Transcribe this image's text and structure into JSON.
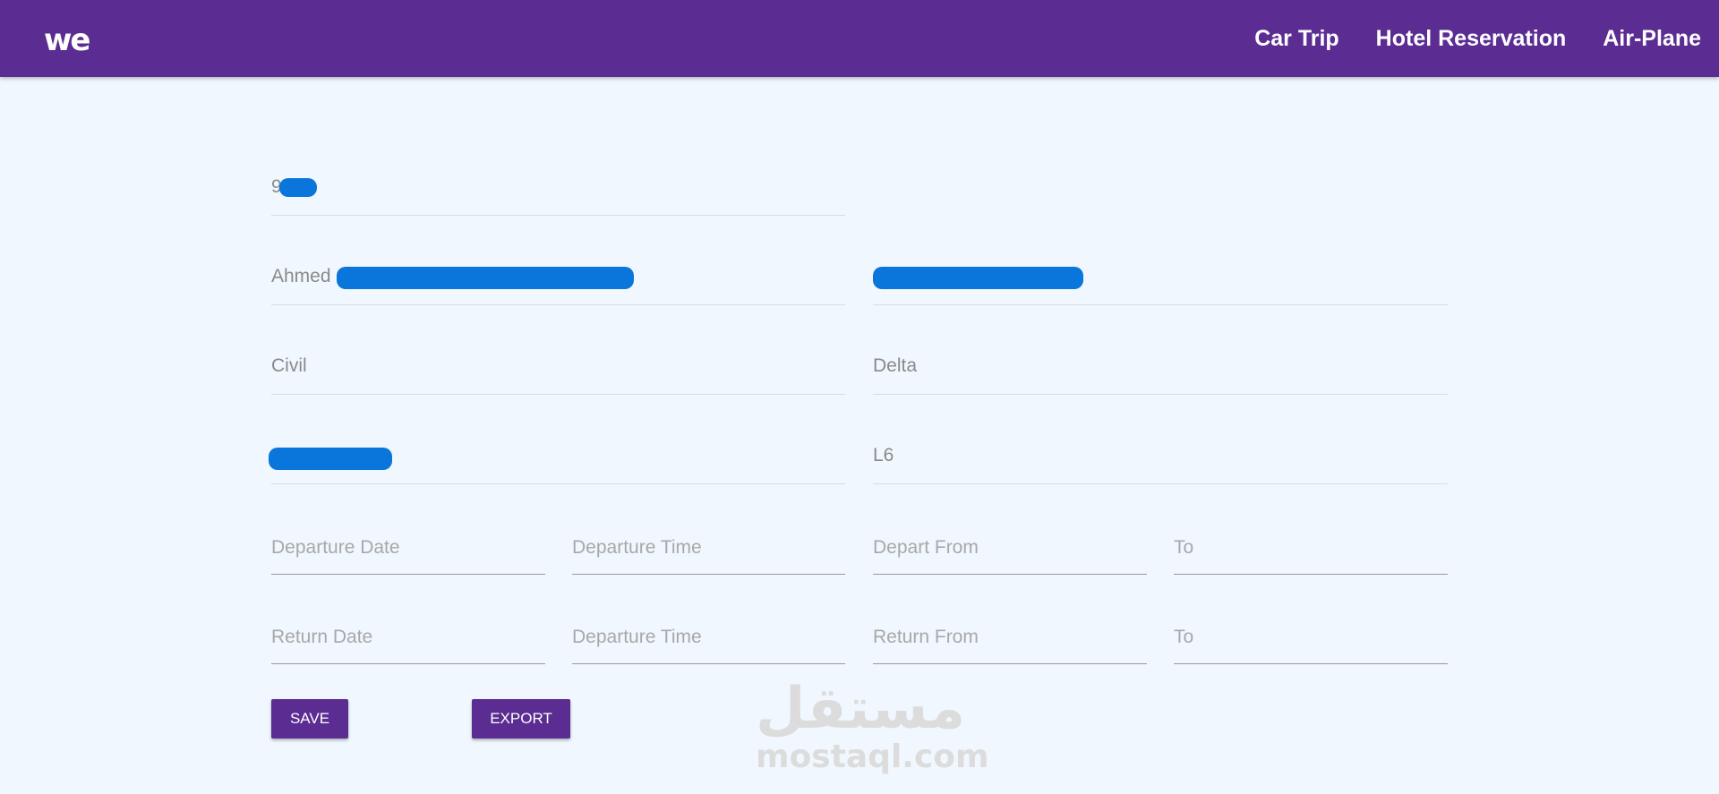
{
  "navbar": {
    "logo": "we",
    "links": [
      "Car Trip",
      "Hotel Reservation",
      "Air-Plane"
    ]
  },
  "form": {
    "id_number": "9",
    "first_name": "Ahmed",
    "department": "Civil",
    "region": "Delta",
    "level": "L6",
    "departure_date_placeholder": "Departure Date",
    "departure_time_placeholder": "Departure Time",
    "depart_from_placeholder": "Depart From",
    "depart_to_placeholder": "To",
    "return_date_placeholder": "Return Date",
    "return_time_placeholder": "Departure Time",
    "return_from_placeholder": "Return From",
    "return_to_placeholder": "To"
  },
  "buttons": {
    "save": "SAVE",
    "export": "EXPORT"
  },
  "watermark": {
    "arabic": "مستقل",
    "latin": "mostaql.com"
  },
  "colors": {
    "brand": "#5b2c91",
    "background": "#f0f7fe",
    "redaction": "#0a76db"
  }
}
